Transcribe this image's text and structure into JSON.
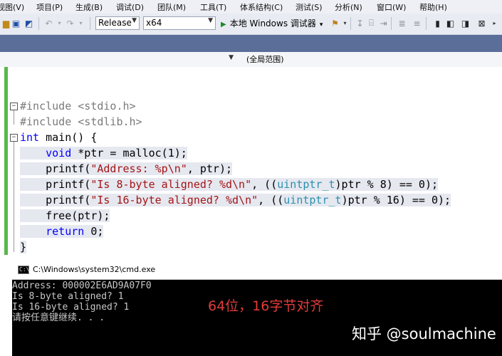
{
  "menu": {
    "items": [
      "视图(V)",
      "项目(P)",
      "生成(B)",
      "调试(D)",
      "团队(M)",
      "工具(T)",
      "体系结构(C)",
      "测试(S)",
      "分析(N)",
      "窗口(W)",
      "帮助(H)"
    ]
  },
  "toolbar": {
    "configuration": "Release",
    "platform": "x64",
    "run_label": "本地 Windows 调试器"
  },
  "navbar": {
    "scope": "(全局范围)"
  },
  "code": {
    "line1": "#include <stdio.h>",
    "line2": "#include <stdlib.h>",
    "line3_kw": "int",
    "line3_rest": " main() {",
    "line4_kw": "void",
    "line4_rest": " *ptr = malloc(1);",
    "line5_fn": "printf(",
    "line5_str": "\"Address: %p\\n\"",
    "line5_rest": ", ptr);",
    "line6_fn": "printf(",
    "line6_str": "\"Is 8-byte aligned? %d\\n\"",
    "line6_mid": ", ((",
    "line6_type": "uintptr_t",
    "line6_rest": ")ptr % 8) == 0);",
    "line7_fn": "printf(",
    "line7_str": "\"Is 16-byte aligned? %d\\n\"",
    "line7_mid": ", ((",
    "line7_type": "uintptr_t",
    "line7_rest": ")ptr % 16) == 0);",
    "line8": "free(ptr);",
    "line9_kw": "return",
    "line9_rest": " 0;",
    "line10": "}"
  },
  "console": {
    "title": "C:\\Windows\\system32\\cmd.exe",
    "lines": [
      "Address: 000002E6AD9A07F0",
      "Is 8-byte aligned? 1",
      "Is 16-byte aligned? 1",
      "请按任意键继续. . ."
    ],
    "annotation": "64位，16字节对齐",
    "watermark": "知乎 @soulmachine"
  },
  "colors": {
    "string": "#a31515",
    "keyword": "#0000ff",
    "type": "#2b91af",
    "preprocessor": "#7a7a7a",
    "change_bar": "#57b84a",
    "annotation": "#e23b3b"
  }
}
